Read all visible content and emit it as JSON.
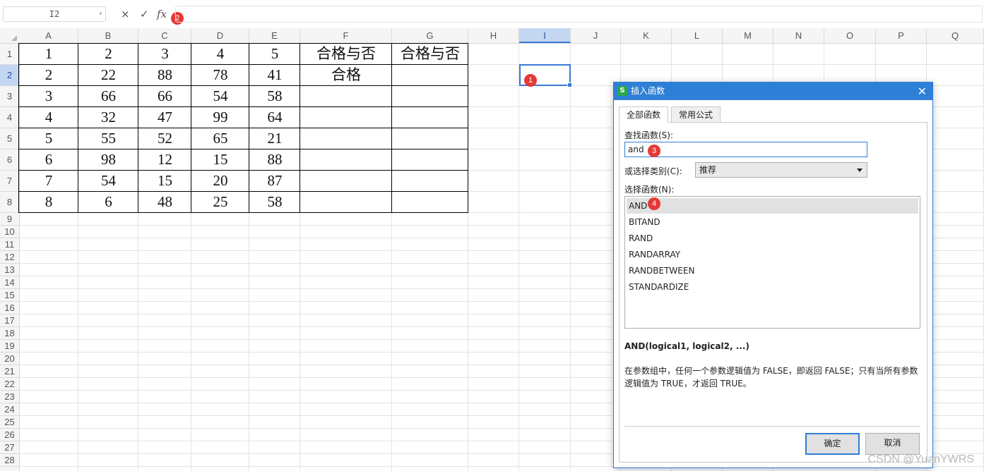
{
  "formula_bar": {
    "cell_ref": "I2",
    "cancel_icon": "×",
    "confirm_icon": "✓",
    "fx_label": "fx",
    "formula": ""
  },
  "columns": [
    "A",
    "B",
    "C",
    "D",
    "E",
    "F",
    "G",
    "H",
    "I",
    "J",
    "K",
    "L",
    "M",
    "N",
    "O",
    "P",
    "Q"
  ],
  "selected_column": "I",
  "rows": [
    "1",
    "2",
    "3",
    "4",
    "5",
    "6",
    "7",
    "8",
    "9",
    "10",
    "11",
    "12",
    "13",
    "14",
    "15",
    "16",
    "17",
    "18",
    "19",
    "20",
    "21",
    "22",
    "23",
    "24",
    "25",
    "26",
    "27",
    "28"
  ],
  "selected_row": "2",
  "table": {
    "header_row": [
      "1",
      "2",
      "3",
      "4",
      "5",
      "合格与否",
      "合格与否"
    ],
    "rows": [
      [
        "2",
        "22",
        "88",
        "78",
        "41",
        "合格",
        ""
      ],
      [
        "3",
        "66",
        "66",
        "54",
        "58",
        "",
        ""
      ],
      [
        "4",
        "32",
        "47",
        "99",
        "64",
        "",
        ""
      ],
      [
        "5",
        "55",
        "52",
        "65",
        "21",
        "",
        ""
      ],
      [
        "6",
        "98",
        "12",
        "15",
        "88",
        "",
        ""
      ],
      [
        "7",
        "54",
        "15",
        "20",
        "87",
        "",
        ""
      ],
      [
        "8",
        "6",
        "48",
        "25",
        "58",
        "",
        ""
      ]
    ]
  },
  "badges": [
    "1",
    "2",
    "3",
    "4"
  ],
  "dialog": {
    "logo": "S",
    "title": "插入函数",
    "close": "✕",
    "tabs": [
      "全部函数",
      "常用公式"
    ],
    "active_tab": 0,
    "search_label": "查找函数(S):",
    "search_value": "and",
    "category_label": "或选择类别(C):",
    "category_value": "推荐",
    "list_label": "选择函数(N):",
    "functions": [
      "AND",
      "BITAND",
      "RAND",
      "RANDARRAY",
      "RANDBETWEEN",
      "STANDARDIZE"
    ],
    "selected_function": "AND",
    "signature": "AND(logical1, logical2, ...)",
    "description": "在参数组中，任何一个参数逻辑值为 FALSE，即返回 FALSE；只有当所有参数逻辑值为 TRUE，才返回 TRUE。",
    "ok_label": "确定",
    "cancel_label": "取消"
  },
  "watermark": "CSDN @YuanYWRS"
}
